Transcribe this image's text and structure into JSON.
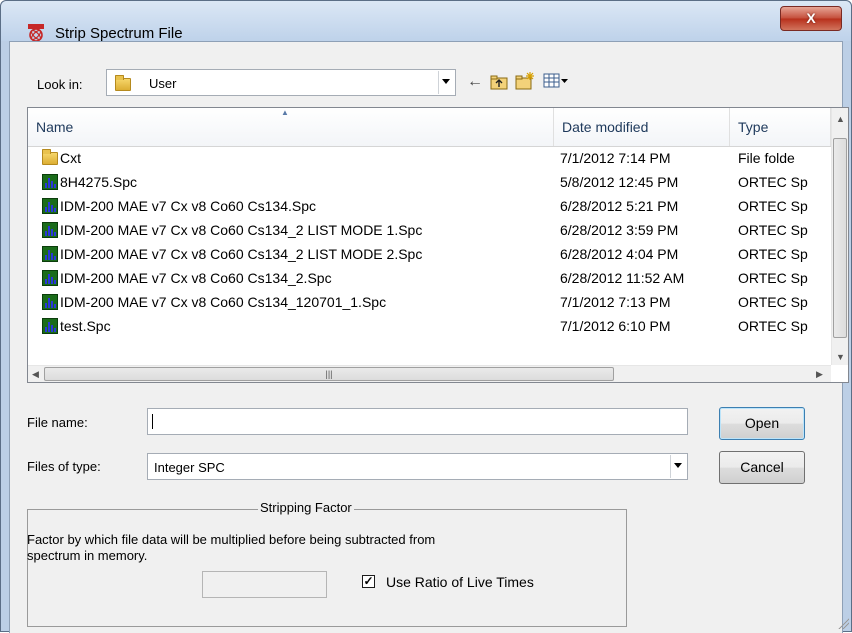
{
  "window": {
    "title": "Strip Spectrum File",
    "close_glyph": "X"
  },
  "look_in": {
    "label": "Look in:",
    "value": "User"
  },
  "toolbar": {
    "back_icon": "←",
    "up_icon": "up-folder-icon",
    "new_folder_icon": "new-folder-icon",
    "view_menu_icon": "view-menu-icon"
  },
  "list": {
    "columns": [
      "Name",
      "Date modified",
      "Type"
    ],
    "rows": [
      {
        "name": "Cxt",
        "date": "7/1/2012 7:14 PM",
        "type": "File folde",
        "icon": "folder"
      },
      {
        "name": "8H4275.Spc",
        "date": "5/8/2012 12:45 PM",
        "type": "ORTEC Sp",
        "icon": "spc"
      },
      {
        "name": "IDM-200 MAE v7 Cx v8 Co60 Cs134.Spc",
        "date": "6/28/2012 5:21 PM",
        "type": "ORTEC Sp",
        "icon": "spc"
      },
      {
        "name": "IDM-200 MAE v7 Cx v8 Co60 Cs134_2 LIST MODE 1.Spc",
        "date": "6/28/2012 3:59 PM",
        "type": "ORTEC Sp",
        "icon": "spc"
      },
      {
        "name": "IDM-200 MAE v7 Cx v8 Co60 Cs134_2 LIST MODE 2.Spc",
        "date": "6/28/2012 4:04 PM",
        "type": "ORTEC Sp",
        "icon": "spc"
      },
      {
        "name": "IDM-200 MAE v7 Cx v8 Co60 Cs134_2.Spc",
        "date": "6/28/2012 11:52 AM",
        "type": "ORTEC Sp",
        "icon": "spc"
      },
      {
        "name": "IDM-200 MAE v7 Cx v8 Co60 Cs134_120701_1.Spc",
        "date": "7/1/2012 7:13 PM",
        "type": "ORTEC Sp",
        "icon": "spc"
      },
      {
        "name": "test.Spc",
        "date": "7/1/2012 6:10 PM",
        "type": "ORTEC Sp",
        "icon": "spc"
      }
    ]
  },
  "file_name": {
    "label": "File name:",
    "value": ""
  },
  "files_of_type": {
    "label": "Files of type:",
    "value": "Integer SPC"
  },
  "buttons": {
    "open": "Open",
    "cancel": "Cancel"
  },
  "stripping": {
    "title": "Stripping Factor",
    "description_line1": "Factor by which file data will be multiplied before being subtracted from",
    "description_line2": "spectrum in memory.",
    "factor_value": "",
    "use_ratio_label": "Use Ratio of Live Times",
    "use_ratio_checked": true
  }
}
